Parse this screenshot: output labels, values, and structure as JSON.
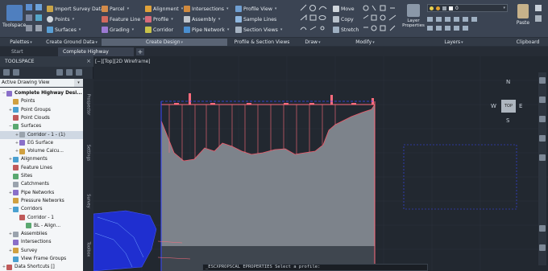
{
  "ribbon": {
    "toolspace_label": "Toolspace",
    "buttons": {
      "import_survey_data": "Import Survey Data",
      "points": "Points",
      "surfaces": "Surfaces",
      "parcel": "Parcel",
      "feature_line": "Feature Line",
      "grading": "Grading",
      "alignment": "Alignment",
      "profile": "Profile",
      "corridor": "Corridor",
      "intersections": "Intersections",
      "assembly": "Assembly",
      "pipe_network": "Pipe Network",
      "profile_view": "Profile View",
      "sample_lines": "Sample Lines",
      "section_views": "Section Views",
      "move": "Move",
      "copy": "Copy",
      "stretch": "Stretch",
      "layer_properties": "Layer Properties",
      "layer_value": "0",
      "paste": "Paste"
    },
    "panels": {
      "palettes": "Palettes",
      "create_ground_data": "Create Ground Data",
      "create_design": "Create Design",
      "profile_section_views": "Profile & Section Views",
      "draw": "Draw",
      "modify": "Modify",
      "layers": "Layers",
      "clipboard": "Clipboard"
    }
  },
  "tabs": {
    "start": "Start",
    "document": "Complete Highway Design*",
    "add": "+"
  },
  "toolspace": {
    "title": "TOOLSPACE",
    "view_selector": "Active Drawing View",
    "side_tabs": [
      "Prospector",
      "Settings",
      "Survey",
      "Toolbox"
    ],
    "tree": [
      {
        "label": "Complete Highway Desi...",
        "level": 0,
        "exp": "−",
        "bold": true
      },
      {
        "label": "Points",
        "level": 1,
        "exp": ""
      },
      {
        "label": "Point Groups",
        "level": 1,
        "exp": "+"
      },
      {
        "label": "Point Clouds",
        "level": 1,
        "exp": ""
      },
      {
        "label": "Surfaces",
        "level": 1,
        "exp": "−"
      },
      {
        "label": "Corridor - 1 - (1)",
        "level": 2,
        "exp": "+",
        "sel": true
      },
      {
        "label": "EG Surface",
        "level": 2,
        "exp": "+"
      },
      {
        "label": "Volume Calcu...",
        "level": 2,
        "exp": "+"
      },
      {
        "label": "Alignments",
        "level": 1,
        "exp": "+"
      },
      {
        "label": "Feature Lines",
        "level": 1,
        "exp": ""
      },
      {
        "label": "Sites",
        "level": 1,
        "exp": ""
      },
      {
        "label": "Catchments",
        "level": 1,
        "exp": ""
      },
      {
        "label": "Pipe Networks",
        "level": 1,
        "exp": "+"
      },
      {
        "label": "Pressure Networks",
        "level": 1,
        "exp": ""
      },
      {
        "label": "Corridors",
        "level": 1,
        "exp": "−"
      },
      {
        "label": "Corridor - 1",
        "level": 2,
        "exp": ""
      },
      {
        "label": "BL - Align...",
        "level": 3,
        "exp": ""
      },
      {
        "label": "Assemblies",
        "level": 1,
        "exp": "+"
      },
      {
        "label": "Intersections",
        "level": 1,
        "exp": ""
      },
      {
        "label": "Survey",
        "level": 1,
        "exp": "+"
      },
      {
        "label": "View Frame Groups",
        "level": 1,
        "exp": ""
      },
      {
        "label": "Data Shortcuts []",
        "level": 0,
        "exp": "+"
      }
    ]
  },
  "drawing": {
    "viewport_label": "[−][Top][2D Wireframe]",
    "viewcube": {
      "north": "N",
      "south": "S",
      "east": "E",
      "west": "W",
      "face": "TOP"
    },
    "command_text": "_ESCXPROPSCAL EPROPERTIES Select a profile:"
  },
  "colors": {
    "ribbon_bg": "#3b4453",
    "canvas_bg": "#222830",
    "profile_fill": "#8a8f96",
    "profile_line": "#f05a6a",
    "accent_blue": "#1f2fd0"
  }
}
